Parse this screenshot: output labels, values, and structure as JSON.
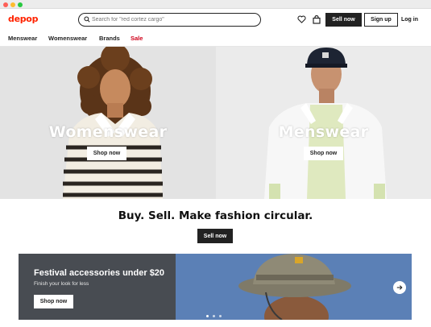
{
  "header": {
    "logo": "depop",
    "search_placeholder": "Search for \"red cortez cargo\"",
    "sell_label": "Sell now",
    "signup_label": "Sign up",
    "login_label": "Log in"
  },
  "nav": {
    "items": [
      "Menswear",
      "Womenswear",
      "Brands",
      "Sale"
    ]
  },
  "hero": {
    "left": {
      "title": "Womenswear",
      "button": "Shop now"
    },
    "right": {
      "title": "Menswear",
      "button": "Shop now"
    }
  },
  "main": {
    "headline": "Buy. Sell. Make fashion circular.",
    "cta": "Sell now"
  },
  "banner": {
    "title": "Festival accessories under $20",
    "subtitle": "Finish your look for less",
    "button": "Shop now",
    "slide_count": 3,
    "active_slide": 1
  },
  "colors": {
    "brand": "#ff2300",
    "sale": "#d0021b",
    "dark_button": "#222222",
    "banner_panel": "#484c52",
    "banner_sky": "#5a7fb5"
  }
}
